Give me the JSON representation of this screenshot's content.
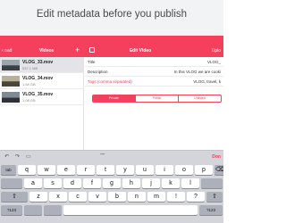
{
  "banner": {
    "title": "Edit metadata before you publish"
  },
  "navbar": {
    "back_label": "‹ oad",
    "left_title": "Videos",
    "add_glyph": "+",
    "right_title": "Edit Video",
    "upload_label": "Uplo"
  },
  "videos": [
    {
      "name": "VLOG_33.mov",
      "size": "537.1 MB",
      "selected": true
    },
    {
      "name": "VLOG_34.mov",
      "size": "1.84 GB",
      "selected": false
    },
    {
      "name": "VLOG_35.mov",
      "size": "1.08 GB",
      "selected": false
    }
  ],
  "form": {
    "title_label": "Title",
    "title_value": "VLOG_",
    "description_label": "Description",
    "description_value": "In this VLOG we are cooki",
    "tags_label": "Tags (comma separated)",
    "tags_value": "VLOG, travel, k",
    "privacy_options": [
      "Private",
      "Public",
      "Unlisted"
    ],
    "privacy_selected": "Private"
  },
  "accessory": {
    "undo_icon": "undo-icon",
    "redo_icon": "redo-icon",
    "paste_icon": "paste-icon",
    "quote_text": "\"\"\"",
    "done_label": "Don"
  },
  "keyboard": {
    "row1": [
      "q",
      "w",
      "e",
      "r",
      "t",
      "y",
      "u",
      "i",
      "o",
      "p"
    ],
    "row2": [
      "a",
      "s",
      "d",
      "f",
      "g",
      "h",
      "j",
      "k",
      "l"
    ],
    "row3": [
      "z",
      "x",
      "c",
      "v",
      "b",
      "n",
      "m",
      "!",
      "?"
    ],
    "shift_glyph": "⇧",
    "numbers_label": "?123",
    "tab_label": "tab",
    "backspace_glyph": "⌫"
  },
  "colors": {
    "accent": "#f4405d",
    "banner_bg": "#f2f3f5",
    "keyboard_bg": "#d3d5da"
  }
}
